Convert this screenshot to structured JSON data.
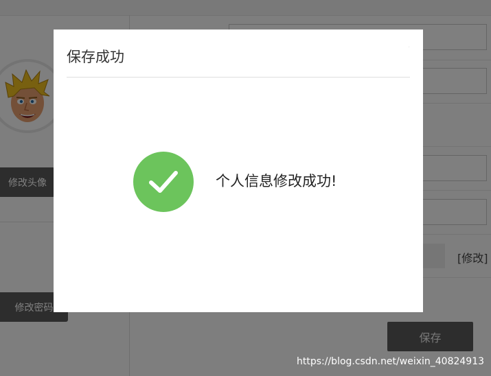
{
  "page": {
    "change_avatar_label": "修改头像",
    "change_password_label": "修改密码",
    "edit_link_label": "[修改]",
    "save_label": "保存",
    "watermark": "https://blog.csdn.net/weixin_40824913"
  },
  "modal": {
    "title": "保存成功",
    "message": "个人信息修改成功!",
    "icon": "check-circle-icon",
    "icon_color": "#6cc45c"
  }
}
